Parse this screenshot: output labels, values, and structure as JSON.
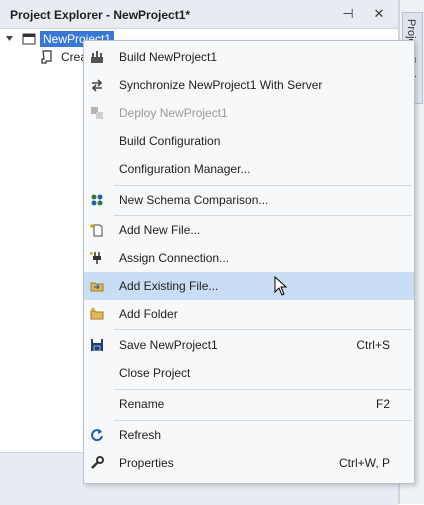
{
  "panel": {
    "title": "Project Explorer - NewProject1*",
    "pin_glyph": "⊣",
    "close_glyph": "✕"
  },
  "tree": {
    "root_label": "NewProject1",
    "child_label": "Crea"
  },
  "side_tab": {
    "label": "Project Explorer"
  },
  "context_menu": {
    "build": "Build NewProject1",
    "synchronize": "Synchronize NewProject1 With Server",
    "deploy": "Deploy NewProject1",
    "build_config": "Build Configuration",
    "config_manager": "Configuration Manager...",
    "schema_comparison": "New Schema Comparison...",
    "add_new_file": "Add New File...",
    "assign_connection": "Assign Connection...",
    "add_existing_file": "Add Existing File...",
    "add_folder": "Add Folder",
    "save": "Save NewProject1",
    "save_shortcut": "Ctrl+S",
    "close_project": "Close Project",
    "rename": "Rename",
    "rename_shortcut": "F2",
    "refresh": "Refresh",
    "properties": "Properties",
    "properties_shortcut": "Ctrl+W, P"
  },
  "colors": {
    "selection": "#3a78d6",
    "hover": "#c9def5"
  }
}
